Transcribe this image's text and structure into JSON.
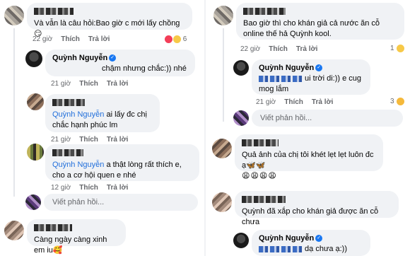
{
  "left": {
    "c1": {
      "text": "Và vẫn là câu hỏi:Bao giờ c mới lấy chồng 😏",
      "time": "22 giờ",
      "like": "Thích",
      "reply": "Trả lời",
      "reaction_count": "6"
    },
    "r1": {
      "name": "Quỳnh Nguyễn",
      "text": "chậm nhưng chắc:)) nhé",
      "time": "21 giờ",
      "like": "Thích",
      "reply": "Trả lời"
    },
    "c2": {
      "tag": "Quỳnh Nguyễn",
      "text": " ai lấy đc chị chắc hạnh phúc lm",
      "time": "21 giờ",
      "like": "Thích",
      "reply": "Trả lời"
    },
    "c3": {
      "tag": "Quỳnh Nguyễn",
      "text": " a thật lòng rất thích e, cho a cơ hội quen e nhé",
      "time": "12 giờ",
      "like": "Thích",
      "reply": "Trả lời"
    },
    "reply_placeholder": "Viết phản hồi...",
    "c4": {
      "text": "Càng ngày càng xinh em iu🥰"
    }
  },
  "right": {
    "c1": {
      "text": "Bao giờ thì cho khán giả cả nước ăn cỗ online thế hả Quỳnh kool.",
      "time": "22 giờ",
      "like": "Thích",
      "reply": "Trả lời",
      "reaction_count": "1"
    },
    "r1": {
      "name": "Quỳnh Nguyễn",
      "text": " ui trời di:)) e cug mog lắm",
      "time": "21 giờ",
      "like": "Thích",
      "reply": "Trả lời",
      "reaction_count": "3"
    },
    "reply_placeholder": "Viết phản hồi...",
    "c2": {
      "text": "Quả ảnh của chị tôi khét lẹt lẹt luôn đc ạ🦋🦋",
      "emoji_row": "😩😩😩😩"
    },
    "c3": {
      "text": "Quỳnh đã xắp cho khán giả được ăn cỗ chưa"
    },
    "r2": {
      "name": "Quỳnh Nguyễn",
      "text": " dạ chưa ạ:))"
    }
  },
  "colors": {
    "tag_blue": "#216fdb",
    "bubble_gray": "#f0f2f5",
    "meta_gray": "#65676b",
    "verified_blue": "#1877f2"
  }
}
